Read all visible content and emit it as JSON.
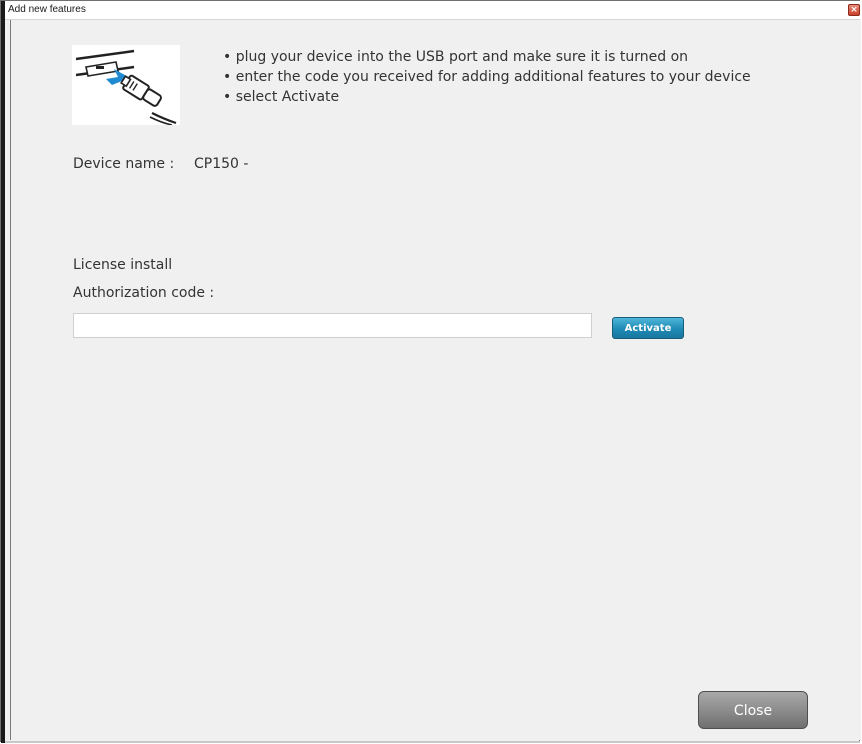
{
  "window": {
    "title": "Add new features"
  },
  "instructions": [
    "• plug your device into the USB port and make sure it is turned on",
    "• enter the code you received for adding additional features to your device",
    "• select Activate"
  ],
  "device": {
    "label": "Device name :",
    "value": "CP150 -"
  },
  "license": {
    "section_label": "License install",
    "auth_label": "Authorization code :",
    "auth_value": "",
    "activate_label": "Activate"
  },
  "footer": {
    "close_label": "Close"
  },
  "icons": {
    "illustration": "usb-plug-icon",
    "window_close": "close-icon"
  },
  "colors": {
    "activate_button": "#1f8ab5",
    "close_button": "#8d8d8d",
    "background": "#f0f0f0"
  }
}
